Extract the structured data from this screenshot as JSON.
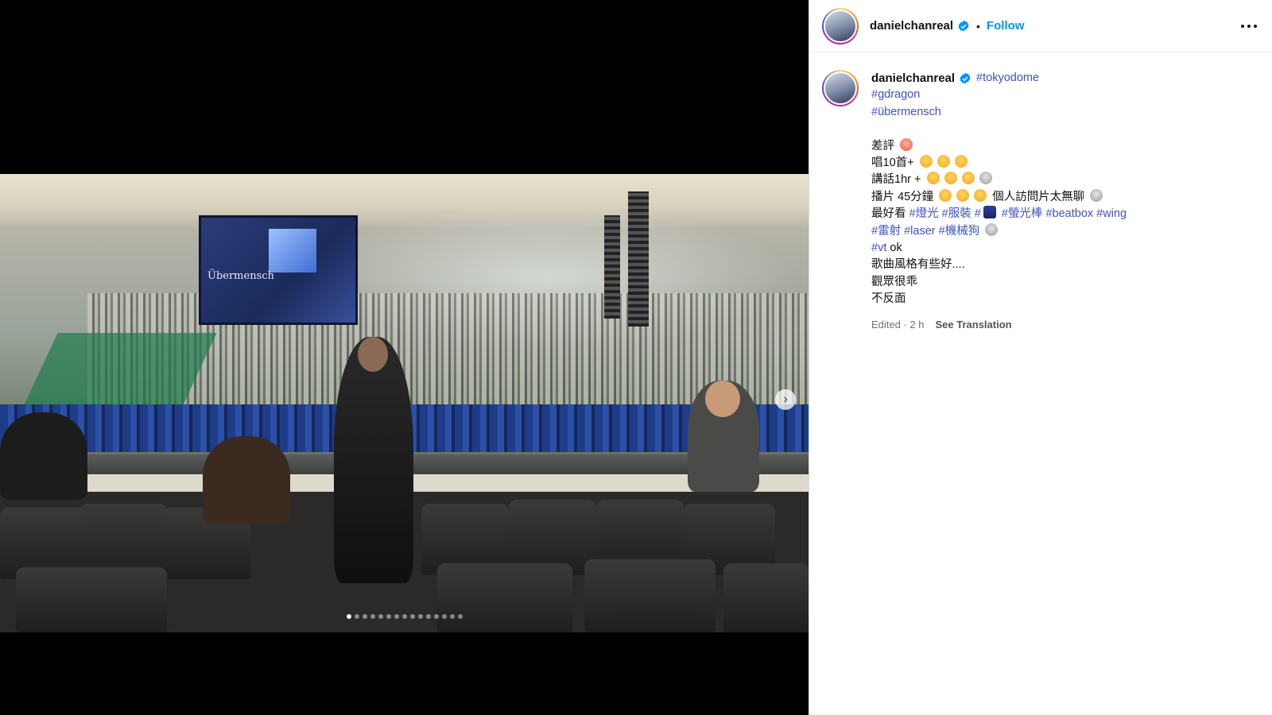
{
  "post": {
    "media_index": 1,
    "media_count": 15,
    "photo_sign": "Übermensch"
  },
  "header": {
    "username": "danielchanreal",
    "separator": "•",
    "follow_label": "Follow"
  },
  "caption": {
    "username": "danielchanreal",
    "hashtag_1": "#tokyodome",
    "hashtag_2": "#gdragon",
    "hashtag_3": "#übermensch",
    "line_1": "差評",
    "line_2": "唱10首+",
    "line_3": "講話1hr +",
    "line_4_a": "播片 45分鐘",
    "line_4_b": "個人訪問片太無聊",
    "line_5_a": "最好看",
    "line_5_tags": [
      "#燈光",
      "#服裝",
      "#"
    ],
    "line_5_tags_b": [
      "#螢光棒",
      "#beatbox",
      "#wing"
    ],
    "line_6_tags": [
      "#雷射",
      "#laser",
      "#機械狗"
    ],
    "line_7_tag": "#vt",
    "line_7_text": "ok",
    "line_8": "歌曲風格有些好....",
    "line_9": "觀眾很乖",
    "line_10": "不反面"
  },
  "meta": {
    "edited": "Edited · 2 h",
    "see_translation": "See Translation"
  },
  "colors": {
    "link": "#3f51d8",
    "follow": "#0095f6",
    "verified": "#0095f6"
  },
  "icons": {
    "verified": "verified-badge-icon",
    "more": "more-options-icon",
    "next": "chevron-right-icon"
  }
}
